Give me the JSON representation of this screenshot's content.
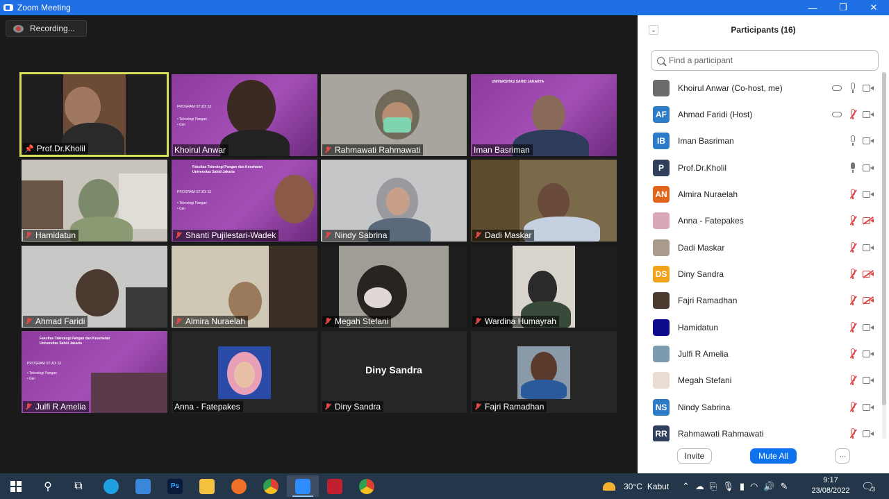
{
  "window": {
    "title": "Zoom Meeting",
    "minimize": "—",
    "maximize": "❐",
    "close": "✕"
  },
  "recording": {
    "label": "Recording..."
  },
  "tiles": [
    {
      "name": "Prof.Dr.Kholil"
    },
    {
      "name": "Khoirul Anwar"
    },
    {
      "name": "Rahmawati Rahmawati"
    },
    {
      "name": "Iman Basriman"
    },
    {
      "name": "Hamidatun"
    },
    {
      "name": "Shanti Pujilestari-Wadek"
    },
    {
      "name": "Nindy Sabrina"
    },
    {
      "name": "Dadi Maskar"
    },
    {
      "name": "Ahmad Faridi"
    },
    {
      "name": "Almira Nuraelah"
    },
    {
      "name": "Megah Stefani"
    },
    {
      "name": "Wardina Humayrah"
    },
    {
      "name": "Julfi R Amelia"
    },
    {
      "name": "Anna - Fatepakes"
    },
    {
      "name": "Diny Sandra",
      "center_name": "Diny Sandra"
    },
    {
      "name": "Fajri Ramadhan"
    }
  ],
  "slides": {
    "faculty": "Fakultas Teknologi Pangan dan Kesehatan Universitas Sahid Jakarta",
    "university": "UNIVERSITAS SAHID JAKARTA",
    "program": "PROGRAM STUDI S1",
    "item1": "• Teknologi Pangan",
    "item2": "• Gizi"
  },
  "panel": {
    "title": "Participants (16)",
    "collapse": "⌄",
    "search_placeholder": "Find a participant",
    "participants": [
      {
        "name": "Khoirul Anwar (Co-host, me)",
        "initials": "",
        "color": "#6b6b6b"
      },
      {
        "name": "Ahmad Faridi (Host)",
        "initials": "AF",
        "color": "#2d7cc7"
      },
      {
        "name": "Iman Basriman",
        "initials": "IB",
        "color": "#2d7cc7"
      },
      {
        "name": "Prof.Dr.Kholil",
        "initials": "P",
        "color": "#2f3f5c"
      },
      {
        "name": "Almira Nuraelah",
        "initials": "AN",
        "color": "#e0661c"
      },
      {
        "name": "Anna - Fatepakes",
        "initials": "",
        "color": "#d9a8b8"
      },
      {
        "name": "Dadi Maskar",
        "initials": "",
        "color": "#a89a8c"
      },
      {
        "name": "Diny Sandra",
        "initials": "DS",
        "color": "#f0a21a"
      },
      {
        "name": "Fajri Ramadhan",
        "initials": "",
        "color": "#4a3a30"
      },
      {
        "name": "Hamidatun",
        "initials": "",
        "color": "#0b0b8a"
      },
      {
        "name": "Julfi R Amelia",
        "initials": "",
        "color": "#7b9bb0"
      },
      {
        "name": "Megah Stefani",
        "initials": "",
        "color": "#e8dcd4"
      },
      {
        "name": "Nindy Sabrina",
        "initials": "NS",
        "color": "#2d7cc7"
      },
      {
        "name": "Rahmawati Rahmawati",
        "initials": "RR",
        "color": "#2f3f5c"
      }
    ],
    "invite": "Invite",
    "mute_all": "Mute All",
    "more": "···"
  },
  "taskbar": {
    "weather_temp": "30°C",
    "weather_desc": "Kabut",
    "time": "9:17",
    "date": "23/08/2022",
    "notifications": "3",
    "app_ps": "Ps"
  }
}
